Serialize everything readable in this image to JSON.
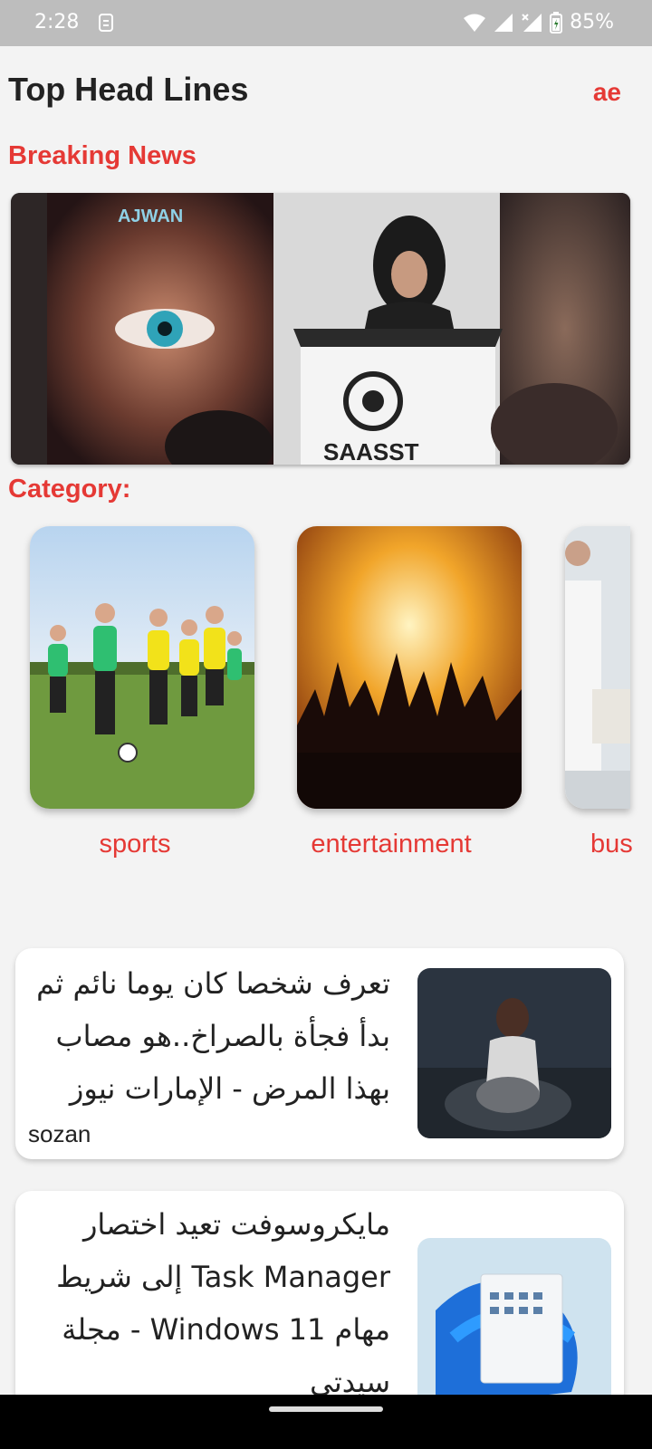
{
  "status_bar": {
    "time": "2:28",
    "battery": "85%"
  },
  "header": {
    "title": "Top Head Lines",
    "country": "ae"
  },
  "breaking_news": {
    "label": "Breaking News"
  },
  "category": {
    "label": "Category:",
    "items": [
      {
        "label": "sports"
      },
      {
        "label": "entertainment"
      },
      {
        "label": "bus"
      }
    ]
  },
  "news": [
    {
      "title": "تعرف شخصا كان يوما نائم ثم بدأ فجأة بالصراخ..هو مصاب بهذا المرض - الإمارات نيوز",
      "source": "sozan"
    },
    {
      "title": "مايكروسوفت تعيد اختصار Task Manager إلى شريط مهام Windows 11 - مجلة سيدتي",
      "source": ""
    }
  ]
}
